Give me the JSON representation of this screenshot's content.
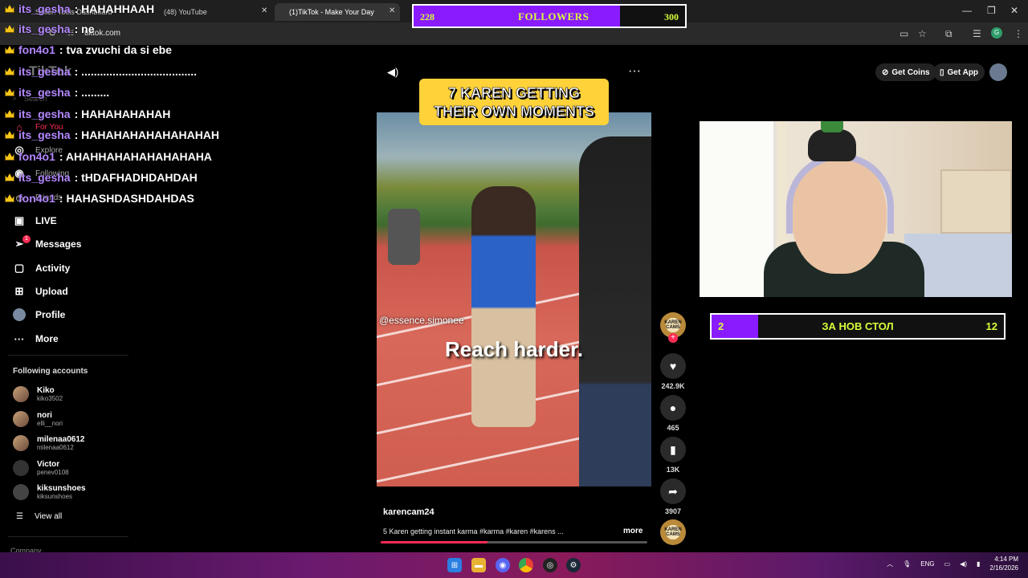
{
  "browser": {
    "tabs": [
      {
        "label": "Seller: Tools Dashboard",
        "active": false
      },
      {
        "label": "(48) YouTube",
        "active": false
      },
      {
        "label": "(1)TikTok - Make Your Day",
        "active": true
      }
    ],
    "url": "tiktok.com"
  },
  "followers_bar": {
    "left": "228",
    "center": "FOLLOWERS",
    "right": "300",
    "progress": 0.76
  },
  "sidebar": {
    "logo": "TikTok",
    "search_placeholder": "Search",
    "nav": [
      {
        "label": "For You",
        "icon": "home-icon"
      },
      {
        "label": "Explore",
        "icon": "compass-icon"
      },
      {
        "label": "Following",
        "icon": "following-icon"
      },
      {
        "label": "Friends",
        "icon": "friends-icon"
      },
      {
        "label": "LIVE",
        "icon": "live-icon"
      },
      {
        "label": "Messages",
        "icon": "messages-icon",
        "badge": "1"
      },
      {
        "label": "Activity",
        "icon": "activity-icon"
      },
      {
        "label": "Upload",
        "icon": "upload-icon"
      },
      {
        "label": "Profile",
        "icon": "profile-icon"
      },
      {
        "label": "More",
        "icon": "more-icon"
      }
    ],
    "following_title": "Following accounts",
    "accounts": [
      {
        "name": "Kiko",
        "handle": "kiko3502"
      },
      {
        "name": "nori",
        "handle": "elli__nori"
      },
      {
        "name": "milenaa0612",
        "handle": "milenaa0612"
      },
      {
        "name": "Victor",
        "handle": "penev0108"
      },
      {
        "name": "kiksunshoes",
        "handle": "kiksunshoes"
      }
    ],
    "view_all": "View all",
    "company": "Company"
  },
  "chat": [
    {
      "user": "its_gesha",
      "msg": ": HAHAHHAAH"
    },
    {
      "user": "its_gesha",
      "msg": ": ne"
    },
    {
      "user": "fon4o1",
      "msg": ": tva zvuchi da si ebe"
    },
    {
      "user": "its_gesha",
      "msg": ": ....................................."
    },
    {
      "user": "its_gesha",
      "msg": ": ........."
    },
    {
      "user": "its_gesha",
      "msg": ": HAHAHAHAHAH"
    },
    {
      "user": "its_gesha",
      "msg": ": HAHAHAHAHAHAHAHAH"
    },
    {
      "user": "fon4o1",
      "msg": ": AHAHHAHAHAHAHAHAHA"
    },
    {
      "user": "its_gesha",
      "msg": ": tHDAFHADHDAHDAH"
    },
    {
      "user": "fon4o1",
      "msg": ": HAHASHDASHDAHDAS"
    }
  ],
  "video": {
    "title_line1": "7 KAREN GETTING",
    "title_line2": "THEIR OWN MOMENTS",
    "watermark": "@essence.simonee",
    "caption": "Reach harder.",
    "username": "karencam24",
    "description": "5 Karen getting instant karma #karma #karen #karens ...",
    "more": "more",
    "progress": 0.4
  },
  "actions": {
    "avatar_label": "KAREN CAMS",
    "likes": "242.9K",
    "comments": "465",
    "saves": "13K",
    "shares": "3907"
  },
  "topbar": {
    "get_coins": "Get Coins",
    "get_app": "Get App"
  },
  "goal_bar": {
    "left": "2",
    "center": "ЗА НОВ СТОЛ",
    "right": "12",
    "progress": 0.16
  },
  "taskbar": {
    "lang": "ENG",
    "time": "4:14 PM",
    "date": "2/16/2026"
  }
}
